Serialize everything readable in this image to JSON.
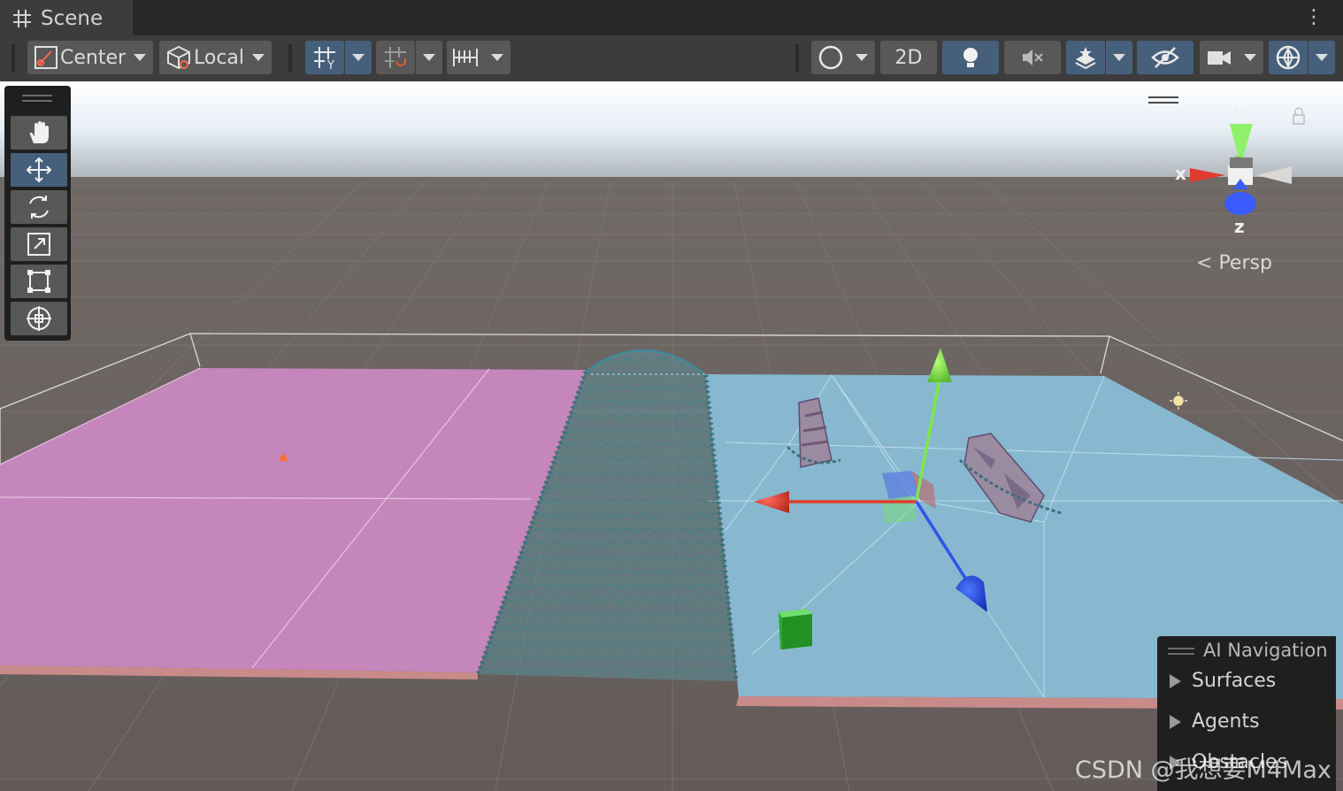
{
  "window": {
    "tab_title": "Scene",
    "menu_icon": "kebab-menu-icon"
  },
  "toolbar": {
    "pivot_label": "Center",
    "space_label": "Local",
    "mode_2d_label": "2D",
    "icons": [
      "grid-snap-icon",
      "increment-snap-icon",
      "ruler-icon",
      "draw-mode-icon",
      "lighting-icon",
      "audio-mute-icon",
      "effects-icon",
      "visibility-icon",
      "camera-icon",
      "gizmos-icon"
    ]
  },
  "tools": {
    "items": [
      "hand-tool",
      "move-tool",
      "rotate-tool",
      "scale-tool",
      "rect-tool",
      "transform-tool"
    ],
    "active": "move-tool"
  },
  "orientation_gizmo": {
    "x_label": "x",
    "y_label": "y",
    "z_label": "z",
    "projection_label": "Persp"
  },
  "ai_navigation": {
    "title": "AI Navigation",
    "items": [
      {
        "label": "Surfaces"
      },
      {
        "label": "Agents"
      },
      {
        "label": "Obstacles"
      }
    ]
  },
  "watermark": "CSDN @我想要M4Max",
  "colors": {
    "pink_surface": "#c486bb",
    "blue_surface": "#87b8d0",
    "x_axis": "#e03c2e",
    "y_axis": "#7ee84a",
    "z_axis": "#2e55e8",
    "active_button": "#46607c"
  }
}
